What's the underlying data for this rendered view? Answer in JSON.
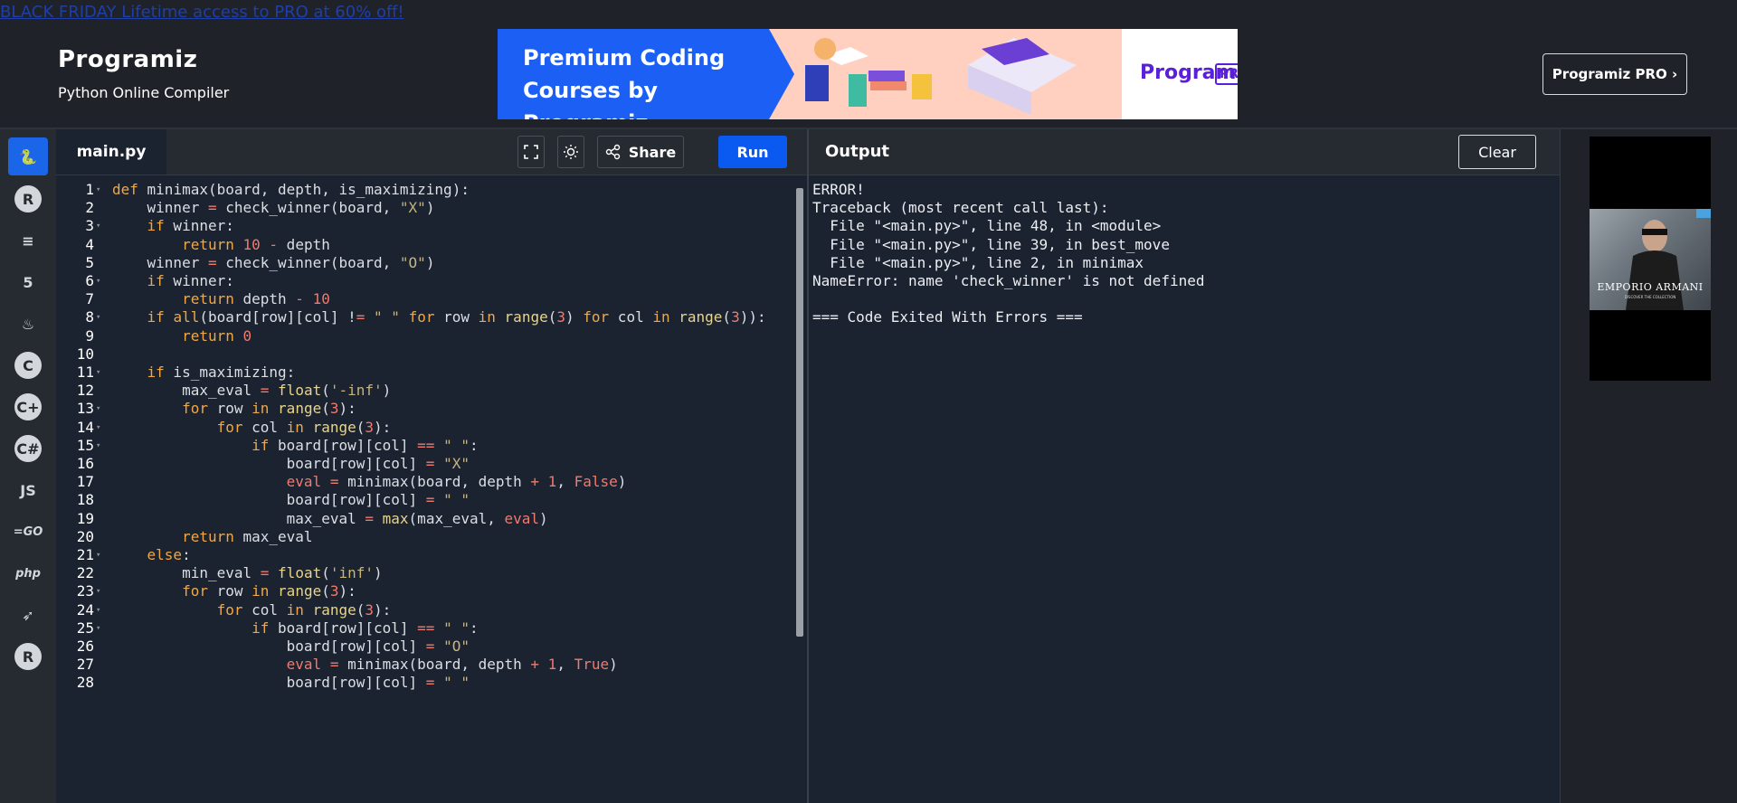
{
  "promo": {
    "label": "BLACK FRIDAY Lifetime access to PRO at 60% off!"
  },
  "header": {
    "logo": "Programiz",
    "subtitle": "Python Online Compiler",
    "banner": {
      "headline_1": "Premium Coding",
      "headline_2": "Courses by Programiz",
      "brand": "Programiz",
      "badge": "PRO"
    },
    "pro_button": "Programiz PRO ›"
  },
  "sidebar": {
    "items": [
      {
        "label": "Python",
        "icon": "python-icon",
        "glyph": "🐍",
        "active": true
      },
      {
        "label": "R",
        "icon": "r-icon",
        "glyph": "R"
      },
      {
        "label": "SQL",
        "icon": "database-icon",
        "glyph": "≡"
      },
      {
        "label": "HTML",
        "icon": "html5-icon",
        "glyph": "5"
      },
      {
        "label": "Java",
        "icon": "java-icon",
        "glyph": "♨"
      },
      {
        "label": "C",
        "icon": "c-icon",
        "glyph": "C"
      },
      {
        "label": "C++",
        "icon": "cpp-icon",
        "glyph": "C+"
      },
      {
        "label": "C#",
        "icon": "csharp-icon",
        "glyph": "C#"
      },
      {
        "label": "JavaScript",
        "icon": "js-icon",
        "glyph": "JS"
      },
      {
        "label": "Go",
        "icon": "go-icon",
        "glyph": "=GO"
      },
      {
        "label": "PHP",
        "icon": "php-icon",
        "glyph": "php"
      },
      {
        "label": "Swift",
        "icon": "swift-icon",
        "glyph": "➶"
      },
      {
        "label": "Rust",
        "icon": "rust-icon",
        "glyph": "R"
      }
    ]
  },
  "editor": {
    "file_name": "main.py",
    "share_label": "Share",
    "run_label": "Run"
  },
  "code_lines": [
    "def minimax(board, depth, is_maximizing):",
    "    winner = check_winner(board, \"X\")",
    "    if winner:",
    "        return 10 - depth",
    "    winner = check_winner(board, \"O\")",
    "    if winner:",
    "        return depth - 10",
    "    if all(board[row][col] != \" \" for row in range(3) for col in range(3)):",
    "        return 0",
    "",
    "    if is_maximizing:",
    "        max_eval = float('-inf')",
    "        for row in range(3):",
    "            for col in range(3):",
    "                if board[row][col] == \" \":",
    "                    board[row][col] = \"X\"",
    "                    eval = minimax(board, depth + 1, False)",
    "                    board[row][col] = \" \"",
    "                    max_eval = max(max_eval, eval)",
    "        return max_eval",
    "    else:",
    "        min_eval = float('inf')",
    "        for row in range(3):",
    "            for col in range(3):",
    "                if board[row][col] == \" \":",
    "                    board[row][col] = \"O\"",
    "                    eval = minimax(board, depth + 1, True)",
    "                    board[row][col] = \" \""
  ],
  "fold_lines": [
    1,
    3,
    6,
    8,
    11,
    13,
    14,
    15,
    21,
    23,
    24,
    25
  ],
  "output": {
    "title": "Output",
    "clear_label": "Clear",
    "lines": [
      "ERROR!",
      "Traceback (most recent call last):",
      "  File \"<main.py>\", line 48, in <module>",
      "  File \"<main.py>\", line 39, in best_move",
      "  File \"<main.py>\", line 2, in minimax",
      "NameError: name 'check_winner' is not defined",
      "",
      "=== Code Exited With Errors ==="
    ]
  },
  "ad": {
    "brand": "EMPORIO ARMANI",
    "tagline": "DISCOVER THE COLLECTION"
  },
  "colors": {
    "accent": "#0a59f0",
    "background": "#1f2329",
    "editor_bg": "#1b2230",
    "keyword": "#f0a847"
  }
}
